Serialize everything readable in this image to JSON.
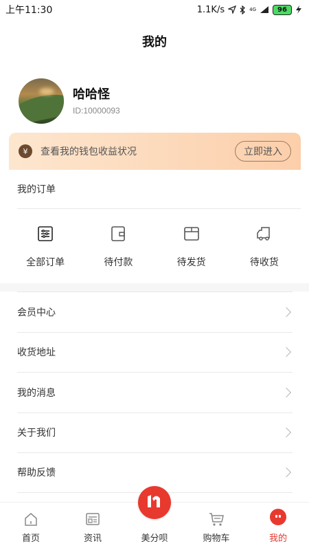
{
  "status_bar": {
    "time": "上午11:30",
    "speed": "1.1K/s",
    "network": "4G",
    "battery": "96"
  },
  "header": {
    "title": "我的"
  },
  "profile": {
    "name": "哈哈怪",
    "id_text": "ID:10000093"
  },
  "wallet": {
    "icon": "yen-icon",
    "text": "查看我的钱包收益状况",
    "button": "立即进入"
  },
  "orders": {
    "title": "我的订单",
    "items": [
      {
        "label": "全部订单",
        "icon": "list-icon"
      },
      {
        "label": "待付款",
        "icon": "wallet-icon"
      },
      {
        "label": "待发货",
        "icon": "box-icon"
      },
      {
        "label": "待收货",
        "icon": "truck-icon"
      }
    ]
  },
  "menu": [
    {
      "label": "会员中心"
    },
    {
      "label": "收货地址"
    },
    {
      "label": "我的消息"
    },
    {
      "label": "关于我们"
    },
    {
      "label": "帮助反馈"
    }
  ],
  "tabs": [
    {
      "label": "首页",
      "icon": "home-icon"
    },
    {
      "label": "资讯",
      "icon": "news-icon"
    },
    {
      "label": "美分呗",
      "icon": "brand-logo-icon"
    },
    {
      "label": "购物车",
      "icon": "cart-icon"
    },
    {
      "label": "我的",
      "icon": "profile-face-icon",
      "active": true
    }
  ],
  "colors": {
    "accent": "#e8392f",
    "wallet_from": "#fde6cf",
    "wallet_to": "#fccfaa"
  }
}
